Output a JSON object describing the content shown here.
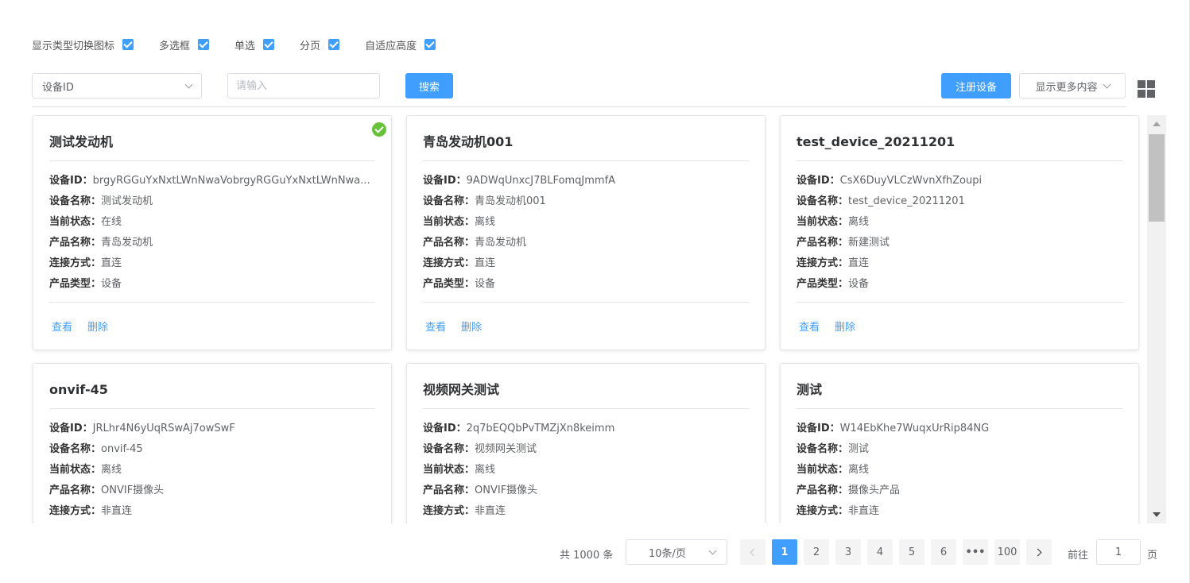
{
  "options": [
    {
      "label": "显示类型切换图标",
      "checked": true
    },
    {
      "label": "多选框",
      "checked": true
    },
    {
      "label": "单选",
      "checked": true
    },
    {
      "label": "分页",
      "checked": true
    },
    {
      "label": "自适应高度",
      "checked": true
    }
  ],
  "toolbar": {
    "field_select": "设备ID",
    "search_placeholder": "请输入",
    "search_button": "搜索",
    "register_button": "注册设备",
    "more_button": "显示更多内容"
  },
  "field_labels": {
    "device_id": "设备ID：",
    "device_name": "设备名称：",
    "status": "当前状态：",
    "product_name": "产品名称：",
    "connection": "连接方式：",
    "product_type": "产品类型："
  },
  "actions": {
    "view": "查看",
    "delete": "删除"
  },
  "cards": [
    {
      "title": "测试发动机",
      "device_id": "brgyRGGuYxNxtLWnNwaVobrgyRGGuYxNxtLWnNwa...",
      "device_name": "测试发动机",
      "status": "在线",
      "product_name": "青岛发动机",
      "connection": "直连",
      "product_type": "设备",
      "selected": true
    },
    {
      "title": "青岛发动机001",
      "device_id": "9ADWqUnxcJ7BLFomqJmmfA",
      "device_name": "青岛发动机001",
      "status": "离线",
      "product_name": "青岛发动机",
      "connection": "直连",
      "product_type": "设备",
      "selected": false
    },
    {
      "title": "test_device_20211201",
      "device_id": "CsX6DuyVLCzWvnXfhZoupi",
      "device_name": "test_device_20211201",
      "status": "离线",
      "product_name": "新建测试",
      "connection": "直连",
      "product_type": "设备",
      "selected": false
    },
    {
      "title": "onvif-45",
      "device_id": "JRLhr4N6yUqRSwAj7owSwF",
      "device_name": "onvif-45",
      "status": "离线",
      "product_name": "ONVIF摄像头",
      "connection": "非直连",
      "selected": false
    },
    {
      "title": "视频网关测试",
      "device_id": "2q7bEQQbPvTMZjXn8keimm",
      "device_name": "视频网关测试",
      "status": "离线",
      "product_name": "ONVIF摄像头",
      "connection": "非直连",
      "selected": false
    },
    {
      "title": "测试",
      "device_id": "W14EbKhe7WuqxUrRip84NG",
      "device_name": "测试",
      "status": "离线",
      "product_name": "摄像头产品",
      "connection": "非直连",
      "selected": false
    }
  ],
  "pagination": {
    "total": "共 1000 条",
    "page_size": "10条/页",
    "pages": [
      "1",
      "2",
      "3",
      "4",
      "5",
      "6"
    ],
    "ellipsis": "•••",
    "last_page": "100",
    "current_page": 1,
    "goto_label": "前往",
    "goto_value": "1",
    "page_unit": "页"
  },
  "colors": {
    "primary": "#409eff",
    "success": "#67c23a"
  }
}
